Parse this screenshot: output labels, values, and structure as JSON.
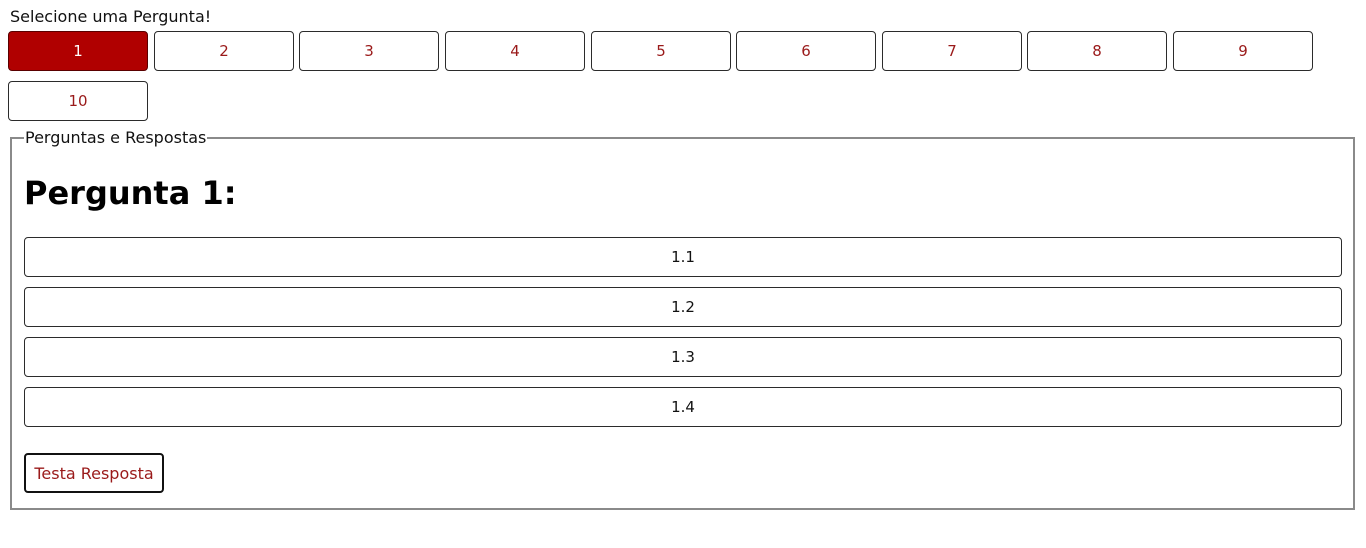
{
  "header": {
    "select_label": "Selecione uma Pergunta!"
  },
  "question_selector": {
    "active_index": 0,
    "buttons": [
      "1",
      "2",
      "3",
      "4",
      "5",
      "6",
      "7",
      "8",
      "9",
      "10"
    ]
  },
  "panel": {
    "legend": "Perguntas e Respostas",
    "question_title": "Pergunta 1:",
    "answers": [
      "1.1",
      "1.2",
      "1.3",
      "1.4"
    ],
    "test_button_label": "Testa Resposta"
  },
  "colors": {
    "active_button_bg": "#b00000",
    "button_text": "#9a1a1a",
    "border": "#2b2b2b"
  }
}
